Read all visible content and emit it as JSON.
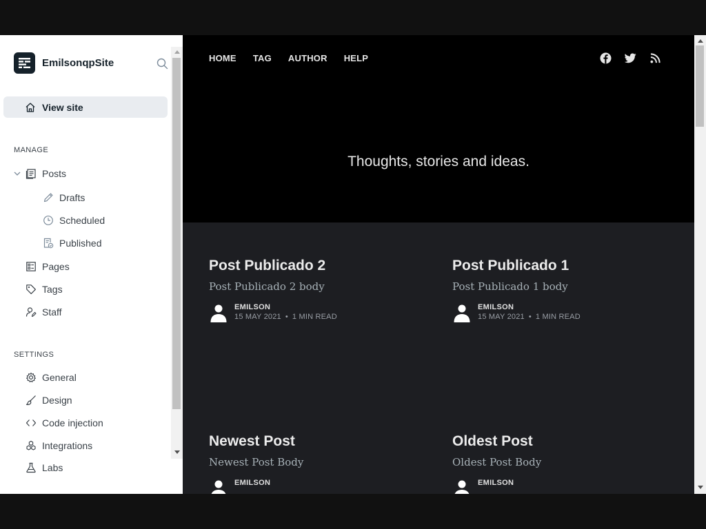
{
  "sidebar": {
    "site_name": "EmilsonqpSite",
    "view_site": "View site",
    "manage_title": "MANAGE",
    "posts": "Posts",
    "drafts": "Drafts",
    "scheduled": "Scheduled",
    "published": "Published",
    "pages": "Pages",
    "tags": "Tags",
    "staff": "Staff",
    "settings_title": "SETTINGS",
    "general": "General",
    "design": "Design",
    "code_injection": "Code injection",
    "integrations": "Integrations",
    "labs": "Labs"
  },
  "site": {
    "nav": [
      "HOME",
      "TAG",
      "AUTHOR",
      "HELP"
    ],
    "social_icons": [
      "facebook-icon",
      "twitter-icon",
      "rss-icon"
    ],
    "tagline": "Thoughts, stories and ideas.",
    "posts": [
      {
        "title": "Post Publicado 2",
        "excerpt": "Post Publicado 2 body",
        "author": "EMILSON",
        "date": "15 MAY 2021",
        "read": "1 MIN READ"
      },
      {
        "title": "Post Publicado 1",
        "excerpt": "Post Publicado 1 body",
        "author": "EMILSON",
        "date": "15 MAY 2021",
        "read": "1 MIN READ"
      },
      {
        "title": "Newest Post",
        "excerpt": "Newest Post Body",
        "author": "EMILSON",
        "date": "",
        "read": ""
      },
      {
        "title": "Oldest Post",
        "excerpt": "Oldest Post Body",
        "author": "EMILSON",
        "date": "",
        "read": ""
      }
    ]
  },
  "colors": {
    "admin_accent": "#15212a",
    "site_background": "#1d1e22",
    "hero_background": "#000000"
  }
}
